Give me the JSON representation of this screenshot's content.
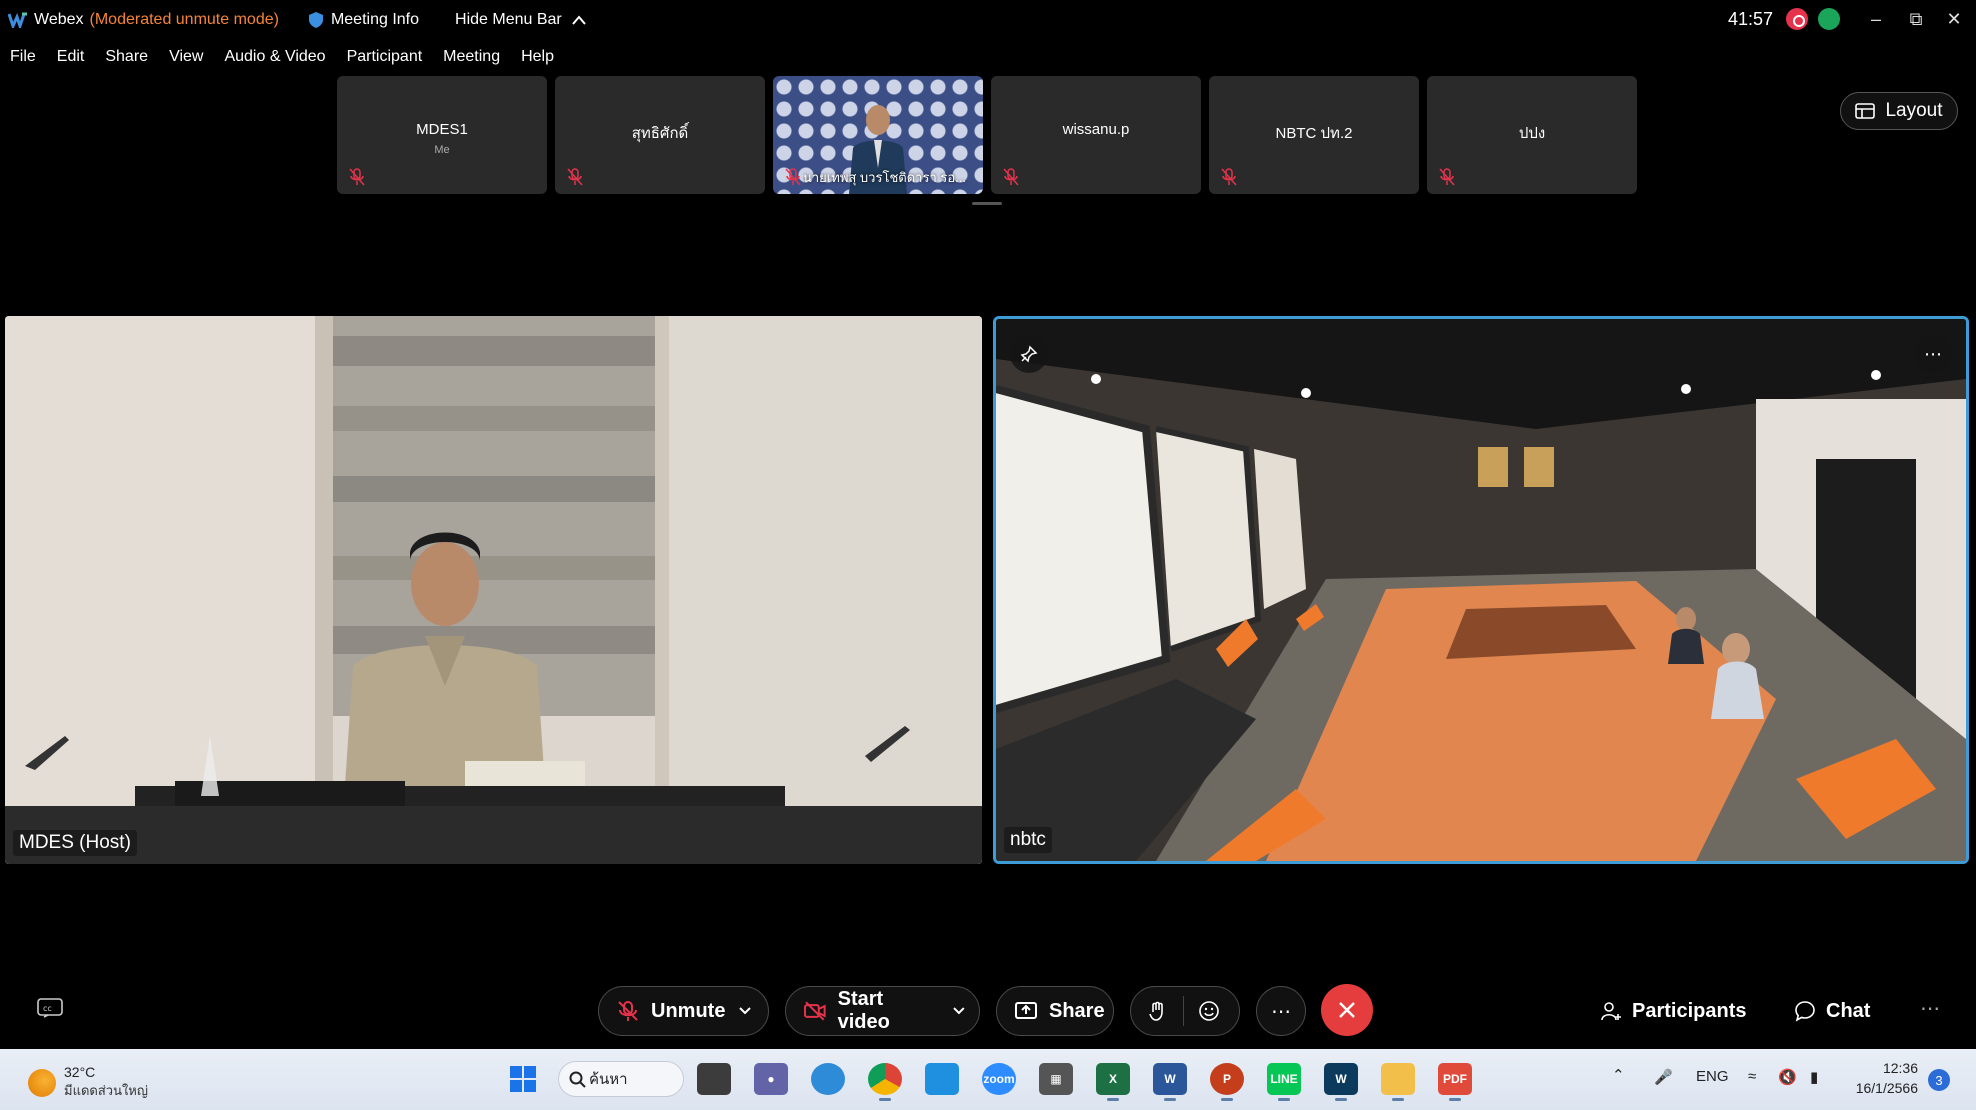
{
  "titlebar": {
    "app_name": "Webex",
    "mode": "(Moderated unmute mode)",
    "meeting_info": "Meeting Info",
    "hide_menu": "Hide Menu Bar",
    "timer": "41:57"
  },
  "menu": [
    "File",
    "Edit",
    "Share",
    "View",
    "Audio & Video",
    "Participant",
    "Meeting",
    "Help"
  ],
  "thumbnails": [
    {
      "name": "MDES1",
      "sub": "Me"
    },
    {
      "name": "สุทธิศักดิ์"
    },
    {
      "name": "นายเทพสุ บวรโชติดารา รอ..."
    },
    {
      "name": "wissanu.p"
    },
    {
      "name": "NBTC ปท.2"
    },
    {
      "name": "ปปง"
    }
  ],
  "layout_label": "Layout",
  "panels": {
    "left_label": "MDES (Host)",
    "right_label": "nbtc"
  },
  "controls": {
    "unmute": "Unmute",
    "start_video": "Start video",
    "share": "Share",
    "participants": "Participants",
    "chat": "Chat"
  },
  "taskbar": {
    "temp": "32°C",
    "weather_desc": "มีแดดส่วนใหญ่",
    "search": "ค้นหา",
    "lang": "ENG",
    "time": "12:36",
    "date": "16/1/2566",
    "notifications": "3"
  }
}
